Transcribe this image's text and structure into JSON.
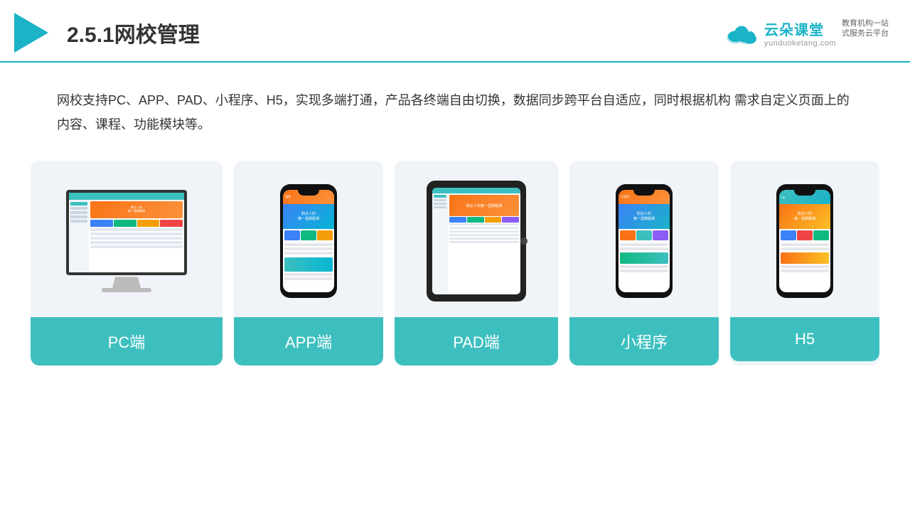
{
  "header": {
    "title": "2.5.1网校管理",
    "logo": {
      "name": "云朵课堂",
      "url": "yunduoketang.com",
      "tagline": "教育机构一站\n式服务云平台"
    }
  },
  "description": "网校支持PC、APP、PAD、小程序、H5，实现多端打通，产品各终端自由切换，数据同步跨平台自适应，同时根据机构\n需求自定义页面上的内容、课程、功能模块等。",
  "cards": [
    {
      "id": "pc",
      "label": "PC端",
      "device": "monitor"
    },
    {
      "id": "app",
      "label": "APP端",
      "device": "phone"
    },
    {
      "id": "pad",
      "label": "PAD端",
      "device": "tablet"
    },
    {
      "id": "miniprogram",
      "label": "小程序",
      "device": "phone"
    },
    {
      "id": "h5",
      "label": "H5",
      "device": "phone"
    }
  ],
  "colors": {
    "teal": "#3dbfbf",
    "border_accent": "#1ab3c8",
    "text_dark": "#333333",
    "bg_card": "#f0f4f8"
  }
}
